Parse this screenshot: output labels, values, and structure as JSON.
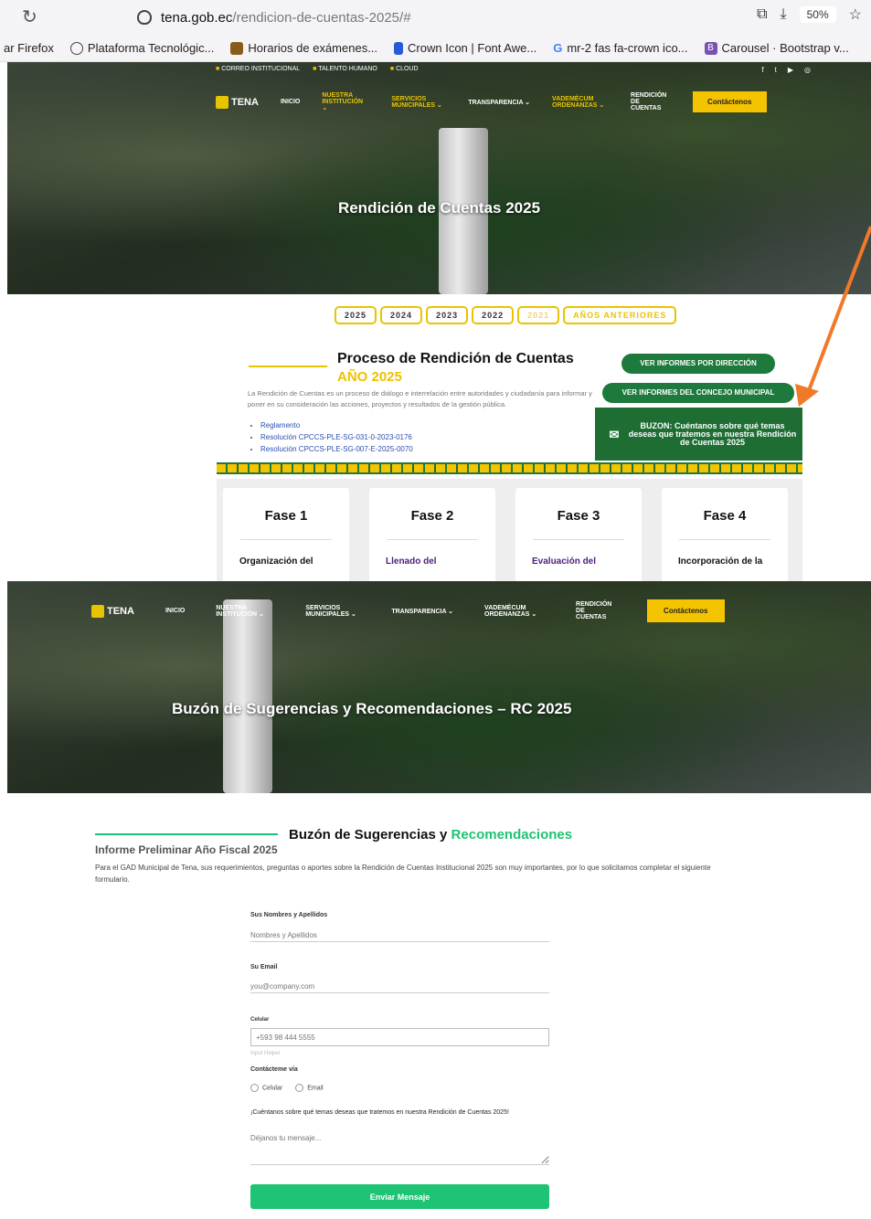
{
  "browser": {
    "url_host": "tena.gob.ec",
    "url_path": "/rendicion-de-cuentas-2025/#",
    "zoom": "50%",
    "bookmarks": [
      "ar Firefox",
      "Plataforma Tecnológic...",
      "Horarios de exámenes...",
      "Crown Icon | Font Awe...",
      "mr-2 fas fa-crown ico...",
      "Carousel · Bootstrap v..."
    ]
  },
  "topbar": {
    "items": [
      "CORREO INSTITUCIONAL",
      "TALENTO HUMANO",
      "CLOUD"
    ]
  },
  "socials": [
    "f",
    "t",
    "▶",
    "◎"
  ],
  "nav": {
    "logo": "TENA",
    "items": [
      "INICIO",
      "NUESTRA INSTITUCIÓN",
      "SERVICIOS MUNICIPALES",
      "TRANSPARENCIA",
      "VADEMÉCUM ORDENANZAS",
      "RENDICIÓN DE CUENTAS"
    ],
    "contact": "Contáctenos"
  },
  "hero1": {
    "title": "Rendición de Cuentas 2025"
  },
  "years": [
    "2025",
    "2024",
    "2023",
    "2022",
    "2021",
    "AÑOS ANTERIORES"
  ],
  "proceso": {
    "title": "Proceso de Rendición de Cuentas",
    "year": "AÑO 2025",
    "description": "La Rendición de Cuentas es un proceso de diálogo e interrelación entre autoridades y ciudadanía para informar y poner en su consideración las acciones, proyectos y resultados de la gestión pública.",
    "links": [
      "Reglamento",
      "Resolución CPCCS-PLE-SG-031-0-2023-0176",
      "Resolución CPCCS-PLE-SG-007-E-2025-0070"
    ],
    "btn_direccion": "VER INFORMES POR DIRECCIÓN",
    "btn_concejo": "VER INFORMES DEL CONCEJO MUNICIPAL",
    "buzon": "BUZON: Cuéntanos sobre qué temas deseas que tratemos en nuestra Rendición de Cuentas 2025"
  },
  "phases": [
    {
      "title": "Fase 1",
      "sub": "Organización del",
      "color": "#111111"
    },
    {
      "title": "Fase 2",
      "sub": "Llenado del",
      "color": "#4a1f7a"
    },
    {
      "title": "Fase 3",
      "sub": "Evaluación del",
      "color": "#4a1f7a"
    },
    {
      "title": "Fase 4",
      "sub": "Incorporación de la",
      "color": "#111111"
    }
  ],
  "hero2": {
    "title": "Buzón de Sugerencias y Recomendaciones – RC 2025"
  },
  "form": {
    "title_a": "Buzón de Sugerencias y ",
    "title_b": "Recomendaciones",
    "subtitle": "Informe Preliminar Año Fiscal 2025",
    "description": "Para el GAD Municipal de Tena, sus requerimientos, preguntas o aportes sobre la Rendición de Cuentas Institucional 2025 son muy importantes, por lo que solicitamos completar el siguiente formulario.",
    "name_label": "Sus Nombres y Apellidos",
    "name_placeholder": "Nombres y Apellidos",
    "email_label": "Su Email",
    "email_placeholder": "you@company.com",
    "phone_label": "Celular",
    "phone_value": "+593 98 444 5555",
    "phone_helper": "Input Helper",
    "contact_label": "Contácteme vía",
    "contact_opt1": "Celular",
    "contact_opt2": "Email",
    "message_label": "¡Cuéntanos sobre qué temas deseas que tratemos en nuestra Rendición de Cuentas 2025!",
    "message_placeholder": "Déjanos tu mensaje...",
    "submit": "Enviar Mensaje"
  },
  "colors": {
    "accent_yellow": "#f5c400",
    "green": "#1e7a3c",
    "form_green": "#1ec373",
    "arrow": "#f07a2a"
  }
}
